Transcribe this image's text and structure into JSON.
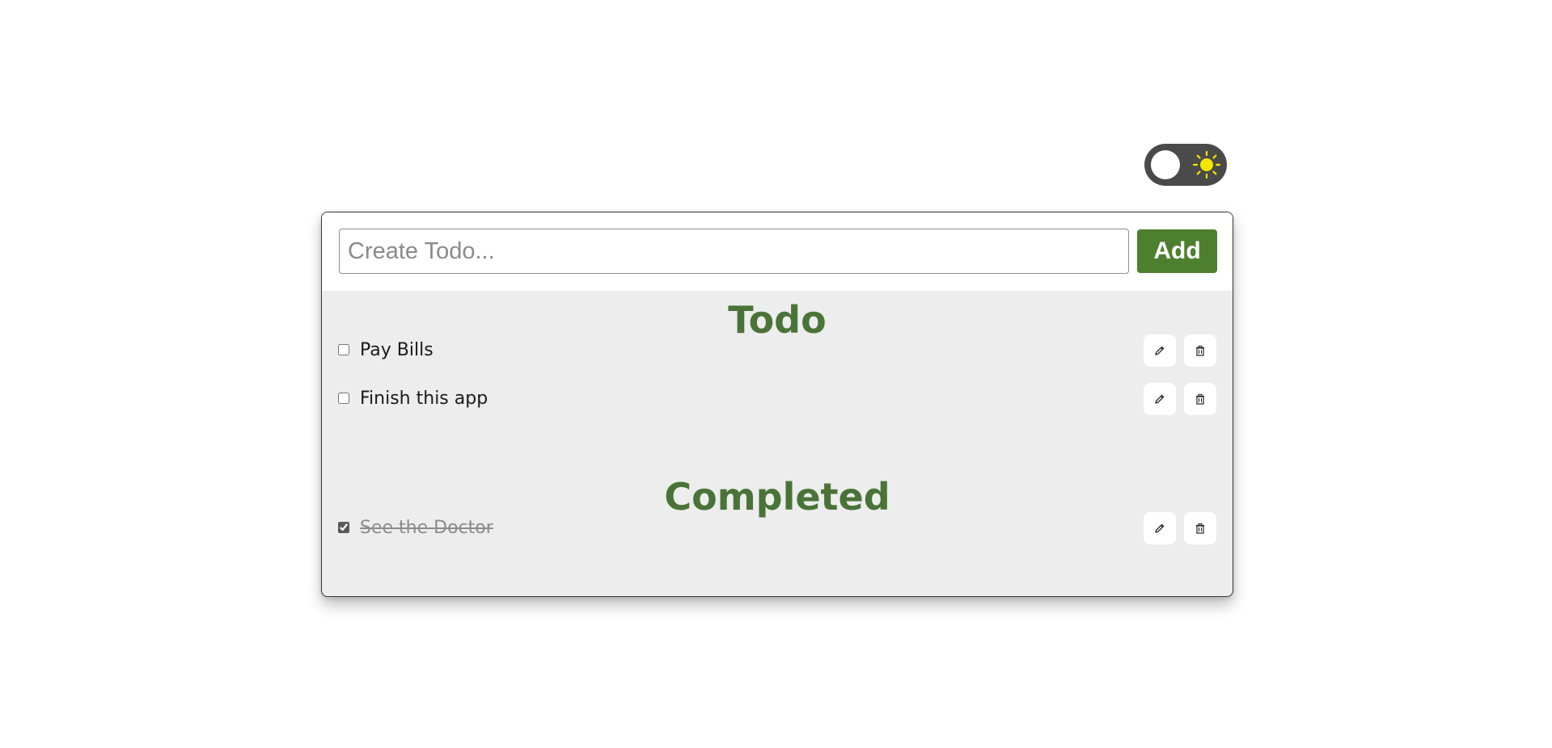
{
  "theme_toggle": {
    "icon": "sun-icon",
    "track_color": "#4a4a4a",
    "sun_color": "#f5e600"
  },
  "input": {
    "placeholder": "Create Todo...",
    "value": ""
  },
  "add_button": {
    "label": "Add",
    "color": "#4e7f2f"
  },
  "todo_section": {
    "title": "Todo",
    "items": [
      {
        "text": "Pay Bills",
        "checked": false,
        "edit_icon": "pencil-icon",
        "delete_icon": "trash-icon"
      },
      {
        "text": "Finish this app",
        "checked": false,
        "edit_icon": "pencil-icon",
        "delete_icon": "trash-icon"
      }
    ]
  },
  "completed_section": {
    "title": "Completed",
    "items": [
      {
        "text": "See the Doctor",
        "checked": true,
        "edit_icon": "pencil-icon",
        "delete_icon": "trash-icon"
      }
    ]
  },
  "colors": {
    "heading": "#4a7338",
    "card_background": "#ededed"
  }
}
